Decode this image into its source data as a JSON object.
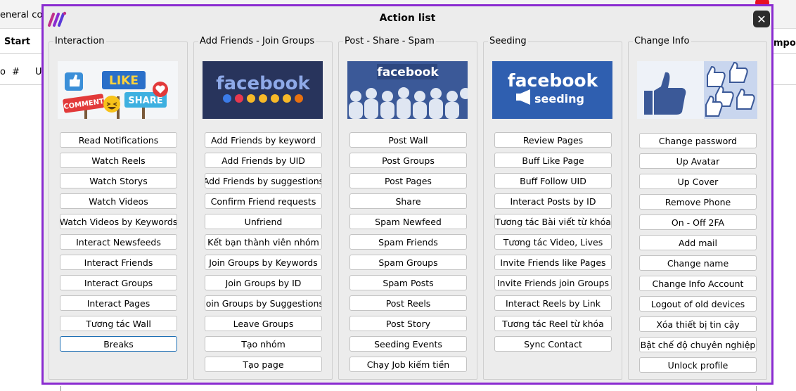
{
  "background": {
    "left_fragment": "eneral confi",
    "start_header": "Start",
    "right_header": "mport A",
    "row_left": "o",
    "row_hash": "#",
    "row_u": "U"
  },
  "dialog": {
    "title": "Action list",
    "close_glyph": "✕"
  },
  "groups": [
    {
      "title": "Interaction",
      "banner": {
        "like": "LIKE",
        "comment": "COMMENT",
        "share": "SHARE"
      },
      "buttons": [
        "Read Notifications",
        "Watch Reels",
        "Watch Storys",
        "Watch Videos",
        "Watch Videos by Keywords",
        "Interact Newsfeeds",
        "Interact Friends",
        "Interact Groups",
        "Interact Pages",
        "Tương tác Wall",
        "Breaks"
      ]
    },
    {
      "title": "Add Friends - Join Groups",
      "banner": {
        "brand": "facebook"
      },
      "buttons": [
        "Add Friends by keyword",
        "Add Friends by UID",
        "Add Friends by suggestions",
        "Confirm Friend requests",
        "Unfriend",
        "Kết bạn thành viên nhóm",
        "Join Groups by Keywords",
        "Join Groups by ID",
        "Join Groups by Suggestions",
        "Leave Groups",
        "Tạo nhóm",
        "Tạo page"
      ]
    },
    {
      "title": "Post - Share - Spam",
      "banner": {
        "brand": "facebook"
      },
      "buttons": [
        "Post Wall",
        "Post Groups",
        "Post Pages",
        "Share",
        "Spam Newfeed",
        "Spam Friends",
        "Spam Groups",
        "Spam Posts",
        "Post Reels",
        "Post Story",
        "Seeding Events",
        "Chạy Job kiếm tiền"
      ]
    },
    {
      "title": "Seeding",
      "banner": {
        "brand": "facebook",
        "sub": "seeding"
      },
      "buttons": [
        "Review Pages",
        "Buff Like Page",
        "Buff Follow UID",
        "Interact Posts by ID",
        "Tương tác Bài viết từ khóa",
        "Tương tác Video, Lives",
        "Invite Friends like Pages",
        "Invite Friends join Groups",
        "Interact Reels by Link",
        "Tương tác Reel từ khóa",
        "Sync Contact"
      ]
    },
    {
      "title": "Change Info",
      "banner": {},
      "buttons": [
        "Change password",
        "Up Avatar",
        "Up Cover",
        "Remove Phone",
        "On - Off 2FA",
        "Add mail",
        "Change name",
        "Change Info Account",
        "Logout of old devices",
        "Xóa thiết bị tin cậy",
        "Bật chế độ chuyên nghiệp",
        "Unlock profile"
      ]
    }
  ],
  "colors": {
    "dialog_border": "#8a2bd0",
    "dialog_bg": "#ececec",
    "selected_border": "#1e6fb4",
    "facebook_blue": "#3b5998"
  }
}
